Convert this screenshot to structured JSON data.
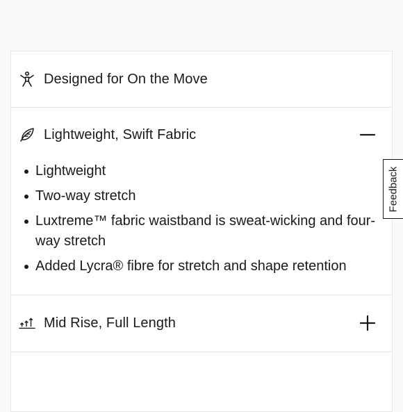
{
  "accordion": {
    "sections": [
      {
        "icon": "person-stretch-icon",
        "title": "Designed for On the Move",
        "toggle": ""
      },
      {
        "icon": "leaf-icon",
        "title": "Lightweight, Swift Fabric",
        "toggle": "minus",
        "bullets": [
          "Lightweight",
          "Two-way stretch",
          "Luxtreme™ fabric waistband is sweat-wicking and four-way stretch",
          "Added Lycra® fibre for stretch and shape retention"
        ]
      },
      {
        "icon": "rise-arrows-icon",
        "title": "Mid Rise, Full Length",
        "toggle": "plus"
      }
    ]
  },
  "feedback": {
    "label": "Feedback"
  },
  "colors": {
    "text": "#1a1a1a",
    "divider": "#e4e4e4",
    "card_background": "#ffffff",
    "page_background": "#fafafa"
  }
}
